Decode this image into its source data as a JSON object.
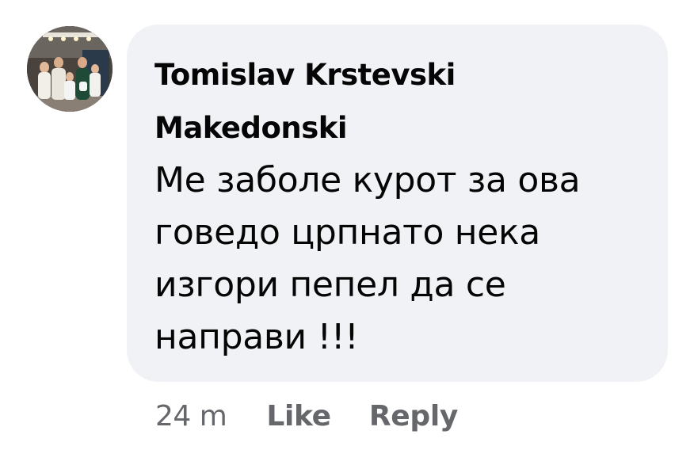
{
  "comment": {
    "author_name": "Tomislav Krstevski Makedonski",
    "text": "Ме заболе курот за ова говедо црпнато нека изгори пепел да се направи !!!",
    "timestamp": "24 m",
    "actions": {
      "like_label": "Like",
      "reply_label": "Reply"
    }
  },
  "colors": {
    "bubble_background": "#f0f2f5",
    "text_primary": "#050505",
    "text_secondary": "#65676b"
  }
}
